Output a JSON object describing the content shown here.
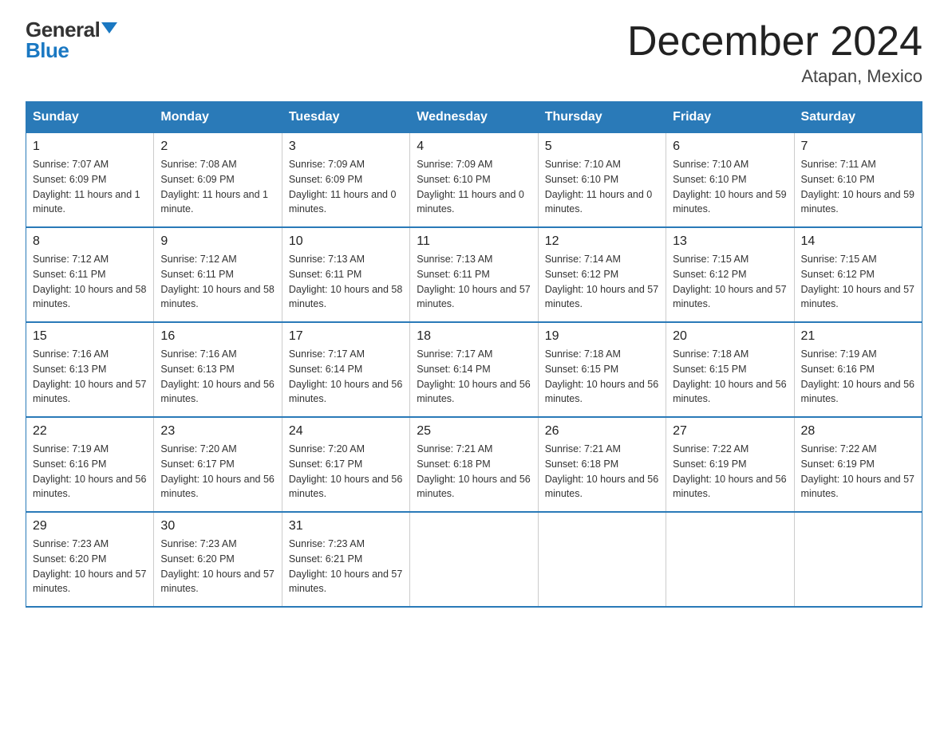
{
  "logo": {
    "general": "General",
    "blue": "Blue"
  },
  "title": "December 2024",
  "subtitle": "Atapan, Mexico",
  "days_of_week": [
    "Sunday",
    "Monday",
    "Tuesday",
    "Wednesday",
    "Thursday",
    "Friday",
    "Saturday"
  ],
  "weeks": [
    [
      {
        "day": "1",
        "sunrise": "7:07 AM",
        "sunset": "6:09 PM",
        "daylight": "11 hours and 1 minute."
      },
      {
        "day": "2",
        "sunrise": "7:08 AM",
        "sunset": "6:09 PM",
        "daylight": "11 hours and 1 minute."
      },
      {
        "day": "3",
        "sunrise": "7:09 AM",
        "sunset": "6:09 PM",
        "daylight": "11 hours and 0 minutes."
      },
      {
        "day": "4",
        "sunrise": "7:09 AM",
        "sunset": "6:10 PM",
        "daylight": "11 hours and 0 minutes."
      },
      {
        "day": "5",
        "sunrise": "7:10 AM",
        "sunset": "6:10 PM",
        "daylight": "11 hours and 0 minutes."
      },
      {
        "day": "6",
        "sunrise": "7:10 AM",
        "sunset": "6:10 PM",
        "daylight": "10 hours and 59 minutes."
      },
      {
        "day": "7",
        "sunrise": "7:11 AM",
        "sunset": "6:10 PM",
        "daylight": "10 hours and 59 minutes."
      }
    ],
    [
      {
        "day": "8",
        "sunrise": "7:12 AM",
        "sunset": "6:11 PM",
        "daylight": "10 hours and 58 minutes."
      },
      {
        "day": "9",
        "sunrise": "7:12 AM",
        "sunset": "6:11 PM",
        "daylight": "10 hours and 58 minutes."
      },
      {
        "day": "10",
        "sunrise": "7:13 AM",
        "sunset": "6:11 PM",
        "daylight": "10 hours and 58 minutes."
      },
      {
        "day": "11",
        "sunrise": "7:13 AM",
        "sunset": "6:11 PM",
        "daylight": "10 hours and 57 minutes."
      },
      {
        "day": "12",
        "sunrise": "7:14 AM",
        "sunset": "6:12 PM",
        "daylight": "10 hours and 57 minutes."
      },
      {
        "day": "13",
        "sunrise": "7:15 AM",
        "sunset": "6:12 PM",
        "daylight": "10 hours and 57 minutes."
      },
      {
        "day": "14",
        "sunrise": "7:15 AM",
        "sunset": "6:12 PM",
        "daylight": "10 hours and 57 minutes."
      }
    ],
    [
      {
        "day": "15",
        "sunrise": "7:16 AM",
        "sunset": "6:13 PM",
        "daylight": "10 hours and 57 minutes."
      },
      {
        "day": "16",
        "sunrise": "7:16 AM",
        "sunset": "6:13 PM",
        "daylight": "10 hours and 56 minutes."
      },
      {
        "day": "17",
        "sunrise": "7:17 AM",
        "sunset": "6:14 PM",
        "daylight": "10 hours and 56 minutes."
      },
      {
        "day": "18",
        "sunrise": "7:17 AM",
        "sunset": "6:14 PM",
        "daylight": "10 hours and 56 minutes."
      },
      {
        "day": "19",
        "sunrise": "7:18 AM",
        "sunset": "6:15 PM",
        "daylight": "10 hours and 56 minutes."
      },
      {
        "day": "20",
        "sunrise": "7:18 AM",
        "sunset": "6:15 PM",
        "daylight": "10 hours and 56 minutes."
      },
      {
        "day": "21",
        "sunrise": "7:19 AM",
        "sunset": "6:16 PM",
        "daylight": "10 hours and 56 minutes."
      }
    ],
    [
      {
        "day": "22",
        "sunrise": "7:19 AM",
        "sunset": "6:16 PM",
        "daylight": "10 hours and 56 minutes."
      },
      {
        "day": "23",
        "sunrise": "7:20 AM",
        "sunset": "6:17 PM",
        "daylight": "10 hours and 56 minutes."
      },
      {
        "day": "24",
        "sunrise": "7:20 AM",
        "sunset": "6:17 PM",
        "daylight": "10 hours and 56 minutes."
      },
      {
        "day": "25",
        "sunrise": "7:21 AM",
        "sunset": "6:18 PM",
        "daylight": "10 hours and 56 minutes."
      },
      {
        "day": "26",
        "sunrise": "7:21 AM",
        "sunset": "6:18 PM",
        "daylight": "10 hours and 56 minutes."
      },
      {
        "day": "27",
        "sunrise": "7:22 AM",
        "sunset": "6:19 PM",
        "daylight": "10 hours and 56 minutes."
      },
      {
        "day": "28",
        "sunrise": "7:22 AM",
        "sunset": "6:19 PM",
        "daylight": "10 hours and 57 minutes."
      }
    ],
    [
      {
        "day": "29",
        "sunrise": "7:23 AM",
        "sunset": "6:20 PM",
        "daylight": "10 hours and 57 minutes."
      },
      {
        "day": "30",
        "sunrise": "7:23 AM",
        "sunset": "6:20 PM",
        "daylight": "10 hours and 57 minutes."
      },
      {
        "day": "31",
        "sunrise": "7:23 AM",
        "sunset": "6:21 PM",
        "daylight": "10 hours and 57 minutes."
      },
      null,
      null,
      null,
      null
    ]
  ]
}
